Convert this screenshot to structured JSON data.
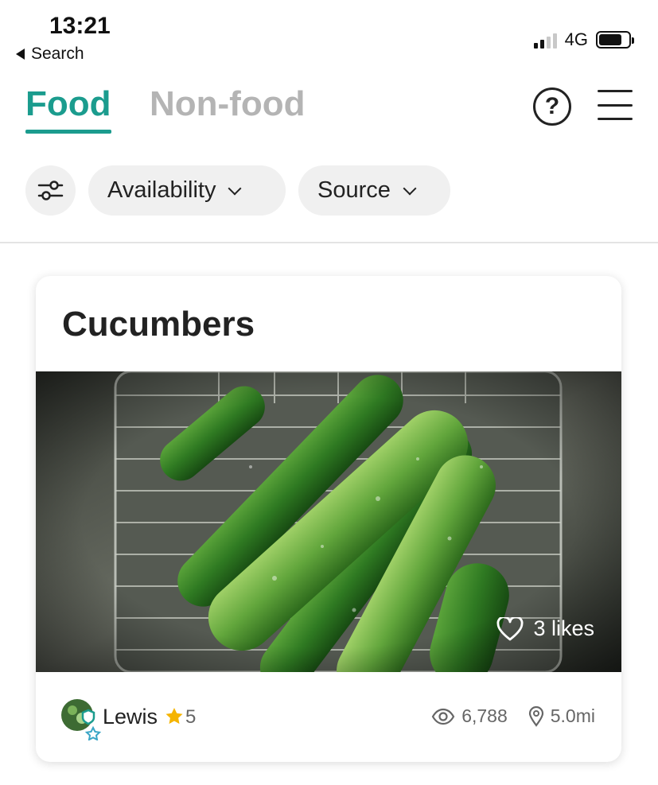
{
  "status_bar": {
    "time": "13:21",
    "back_label": "Search",
    "network": "4G"
  },
  "tabs": [
    {
      "label": "Food",
      "active": true
    },
    {
      "label": "Non-food",
      "active": false
    }
  ],
  "header_icons": [
    "help-icon",
    "menu-icon"
  ],
  "filters": {
    "settings_icon": "sliders-icon",
    "pills": [
      {
        "label": "Availability"
      },
      {
        "label": "Source"
      }
    ]
  },
  "listing": {
    "title": "Cucumbers",
    "likes": "3 likes",
    "user": {
      "name": "Lewis",
      "rating": "5"
    },
    "views": "6,788",
    "distance": "5.0mi"
  },
  "colors": {
    "accent": "#1b9c8e",
    "inactive_tab": "#b4b4b4",
    "star": "#f5b400",
    "pill_bg": "#f0f0f0"
  }
}
